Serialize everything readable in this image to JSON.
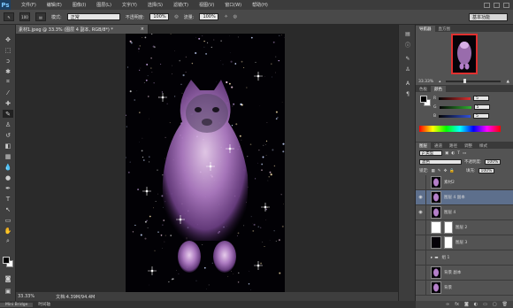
{
  "app": {
    "logo": "Ps"
  },
  "menu": [
    "文件(F)",
    "编辑(E)",
    "图像(I)",
    "图层(L)",
    "文字(Y)",
    "选择(S)",
    "滤镜(T)",
    "视图(V)",
    "窗口(W)",
    "帮助(H)"
  ],
  "options": {
    "brush_size": "100",
    "mode_label": "模式:",
    "mode_value": "正常",
    "opacity_label": "不透明度:",
    "opacity_value": "100%",
    "flow_label": "流量:",
    "flow_value": "100%",
    "workspace": "基本功能"
  },
  "document": {
    "tab_title": "素材1.jpeg @ 33.3% (图层 4 副本, RGB/8*) *",
    "close": "×",
    "zoom": "33.33%",
    "doc_info": "文档:4.39M/94.4M"
  },
  "bottom_tabs": [
    "Mini Bridge",
    "时间轴"
  ],
  "navigator": {
    "tabs": [
      "导航器",
      "直方图"
    ],
    "zoom": "33.33%"
  },
  "color": {
    "tabs": [
      "色板",
      "颜色"
    ],
    "channels": [
      {
        "label": "R",
        "value": "5",
        "color": "#d83030"
      },
      {
        "label": "G",
        "value": "5",
        "color": "#30b030"
      },
      {
        "label": "B",
        "value": "5",
        "color": "#3050d8"
      }
    ]
  },
  "layers": {
    "tabs": [
      "图层",
      "通道",
      "路径",
      "调整",
      "样式"
    ],
    "filter_label": "ρ 类型",
    "blend_mode": "滤色",
    "opacity_label": "不透明度:",
    "opacity_value": "100%",
    "lock_label": "锁定:",
    "fill_label": "填充:",
    "fill_value": "100%",
    "items": [
      {
        "name": "素材2",
        "visible": false,
        "thumb": "galaxy",
        "mask": false,
        "selected": false
      },
      {
        "name": "图层 4 副本",
        "visible": true,
        "thumb": "galaxy",
        "mask": false,
        "selected": true
      },
      {
        "name": "图层 4",
        "visible": true,
        "thumb": "galaxy",
        "mask": false,
        "selected": false
      },
      {
        "name": "图层 2",
        "visible": false,
        "thumb": "white",
        "mask": true,
        "selected": false
      },
      {
        "name": "图层 3",
        "visible": false,
        "thumb": "dark",
        "mask": true,
        "selected": false
      },
      {
        "name": "组 1",
        "visible": false,
        "thumb": "folder",
        "mask": false,
        "selected": false
      },
      {
        "name": "背景 副本",
        "visible": false,
        "thumb": "galaxy",
        "mask": false,
        "selected": false
      },
      {
        "name": "背景",
        "visible": false,
        "thumb": "galaxy",
        "mask": false,
        "selected": false
      }
    ]
  }
}
